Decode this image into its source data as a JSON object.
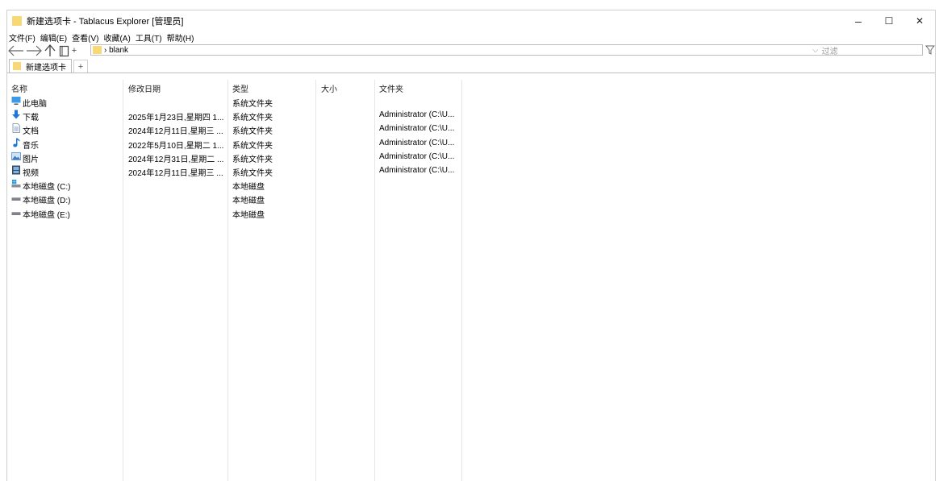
{
  "window": {
    "title": "新建选项卡 - Tablacus Explorer [管理员]",
    "controls": {
      "minimize": "–",
      "maximize": "☐",
      "close": "✕"
    }
  },
  "menu": [
    "文件(F)",
    "编辑(E)",
    "查看(V)",
    "收藏(A)",
    "工具(T)",
    "帮助(H)"
  ],
  "address": {
    "path": "› blank",
    "filter_placeholder": "过滤"
  },
  "tabs": [
    {
      "label": "新建选项卡"
    }
  ],
  "tab_add_label": "+",
  "columns": {
    "name": "名称",
    "date": "修改日期",
    "type": "类型",
    "size": "大小",
    "folder": "文件夹"
  },
  "rows": [
    {
      "icon": "computer-icon",
      "name": "此电脑",
      "date": "",
      "type": "系统文件夹",
      "size": "",
      "folder": ""
    },
    {
      "icon": "download-icon",
      "name": "下载",
      "date": "2025年1月23日,星期四 1...",
      "type": "系统文件夹",
      "size": "",
      "folder": "Administrator (C:\\U..."
    },
    {
      "icon": "document-icon",
      "name": "文档",
      "date": "2024年12月11日,星期三 ...",
      "type": "系统文件夹",
      "size": "",
      "folder": "Administrator (C:\\U..."
    },
    {
      "icon": "music-icon",
      "name": "音乐",
      "date": "2022年5月10日,星期二 1...",
      "type": "系统文件夹",
      "size": "",
      "folder": "Administrator (C:\\U..."
    },
    {
      "icon": "pictures-icon",
      "name": "图片",
      "date": "2024年12月31日,星期二 ...",
      "type": "系统文件夹",
      "size": "",
      "folder": "Administrator (C:\\U..."
    },
    {
      "icon": "video-icon",
      "name": "视频",
      "date": "2024年12月11日,星期三 ...",
      "type": "系统文件夹",
      "size": "",
      "folder": "Administrator (C:\\U..."
    },
    {
      "icon": "system-drive-icon",
      "name": "本地磁盘 (C:)",
      "date": "",
      "type": "本地磁盘",
      "size": "",
      "folder": ""
    },
    {
      "icon": "drive-icon",
      "name": "本地磁盘 (D:)",
      "date": "",
      "type": "本地磁盘",
      "size": "",
      "folder": ""
    },
    {
      "icon": "drive-icon",
      "name": "本地磁盘 (E:)",
      "date": "",
      "type": "本地磁盘",
      "size": "",
      "folder": ""
    }
  ],
  "colors": {
    "folder": "#f8d775",
    "border": "#bdbdbd",
    "icon_blue": "#1e78d6"
  }
}
